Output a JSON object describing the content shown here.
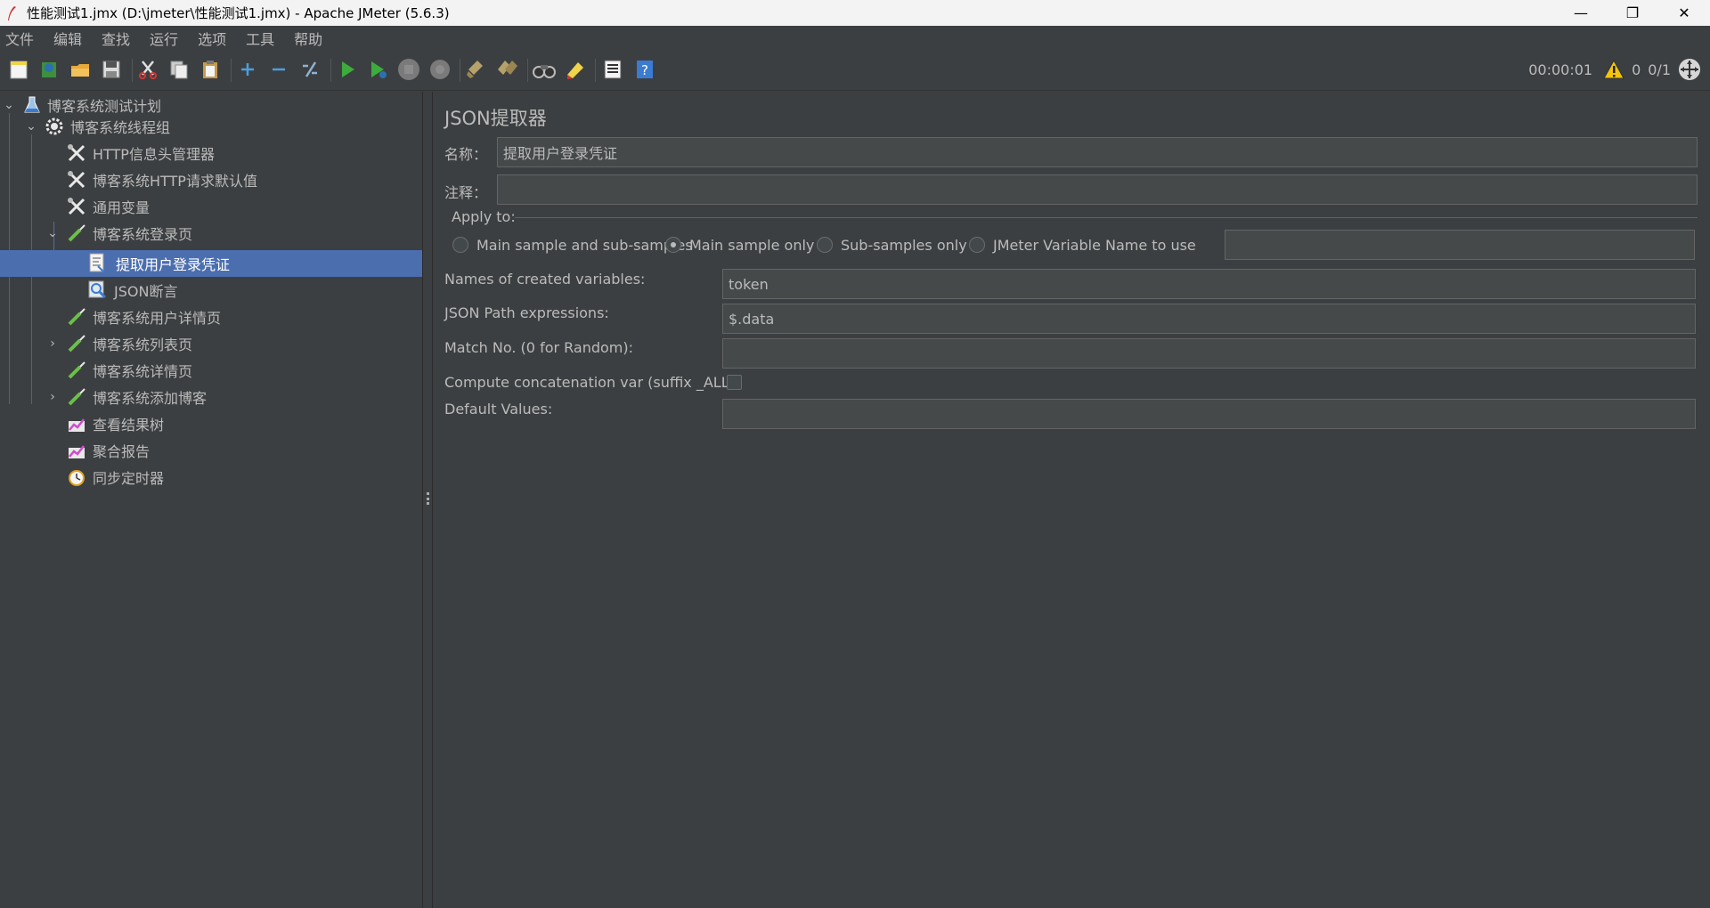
{
  "window": {
    "title": "性能测试1.jmx (D:\\jmeter\\性能测试1.jmx) - Apache JMeter (5.6.3)",
    "minimize_glyph": "—",
    "restore_glyph": "❐",
    "close_glyph": "✕"
  },
  "menu": [
    "文件",
    "编辑",
    "查找",
    "运行",
    "选项",
    "工具",
    "帮助"
  ],
  "toolbar": {
    "buttons": [
      "new-icon",
      "templates-icon",
      "open-icon",
      "save-icon",
      "cut-icon",
      "copy-icon",
      "paste-icon",
      "expand-icon",
      "collapse-icon",
      "toggle-icon",
      "start-icon",
      "start-no-pause-icon",
      "stop-icon",
      "shutdown-icon",
      "clear-icon",
      "clear-all-icon",
      "search-icon",
      "reset-search-icon",
      "function-helper-icon",
      "help-icon"
    ],
    "timer": "00:00:01",
    "warning_count": "0",
    "threads": "0/1"
  },
  "tree": {
    "items": [
      {
        "label": "博客系统测试计划",
        "icon": "test-plan-icon"
      },
      {
        "label": "博客系统线程组",
        "icon": "thread-group-icon"
      },
      {
        "label": "HTTP信息头管理器",
        "icon": "config-element-icon"
      },
      {
        "label": "博客系统HTTP请求默认值",
        "icon": "config-element-icon"
      },
      {
        "label": "通用变量",
        "icon": "config-element-icon"
      },
      {
        "label": "博客系统登录页",
        "icon": "sampler-icon"
      },
      {
        "label": "提取用户登录凭证",
        "icon": "extractor-icon"
      },
      {
        "label": "JSON断言",
        "icon": "assertion-icon"
      },
      {
        "label": "博客系统用户详情页",
        "icon": "sampler-icon"
      },
      {
        "label": "博客系统列表页",
        "icon": "sampler-icon"
      },
      {
        "label": "博客系统详情页",
        "icon": "sampler-icon"
      },
      {
        "label": "博客系统添加博客",
        "icon": "sampler-icon"
      },
      {
        "label": "查看结果树",
        "icon": "listener-icon"
      },
      {
        "label": "聚合报告",
        "icon": "listener-icon"
      },
      {
        "label": "同步定时器",
        "icon": "timer-icon"
      }
    ],
    "selected": "提取用户登录凭证"
  },
  "panel": {
    "title": "JSON提取器",
    "name_label": "名称：",
    "name_value": "提取用户登录凭证",
    "comment_label": "注释：",
    "comment_value": "",
    "apply_to_label": "Apply to:",
    "apply_options": [
      "Main sample and sub-samples",
      "Main sample only",
      "Sub-samples only",
      "JMeter Variable Name to use"
    ],
    "apply_selected": "Main sample only",
    "jmeter_var_value": "",
    "names_label": "Names of created variables:",
    "names_value": "token",
    "json_path_label": "JSON Path expressions:",
    "json_path_value": "$.data",
    "match_no_label": "Match No. (0 for Random):",
    "match_no_value": "",
    "concat_label": "Compute concatenation var (suffix _ALL):",
    "concat_checked": false,
    "default_label": "Default Values:",
    "default_value": ""
  }
}
